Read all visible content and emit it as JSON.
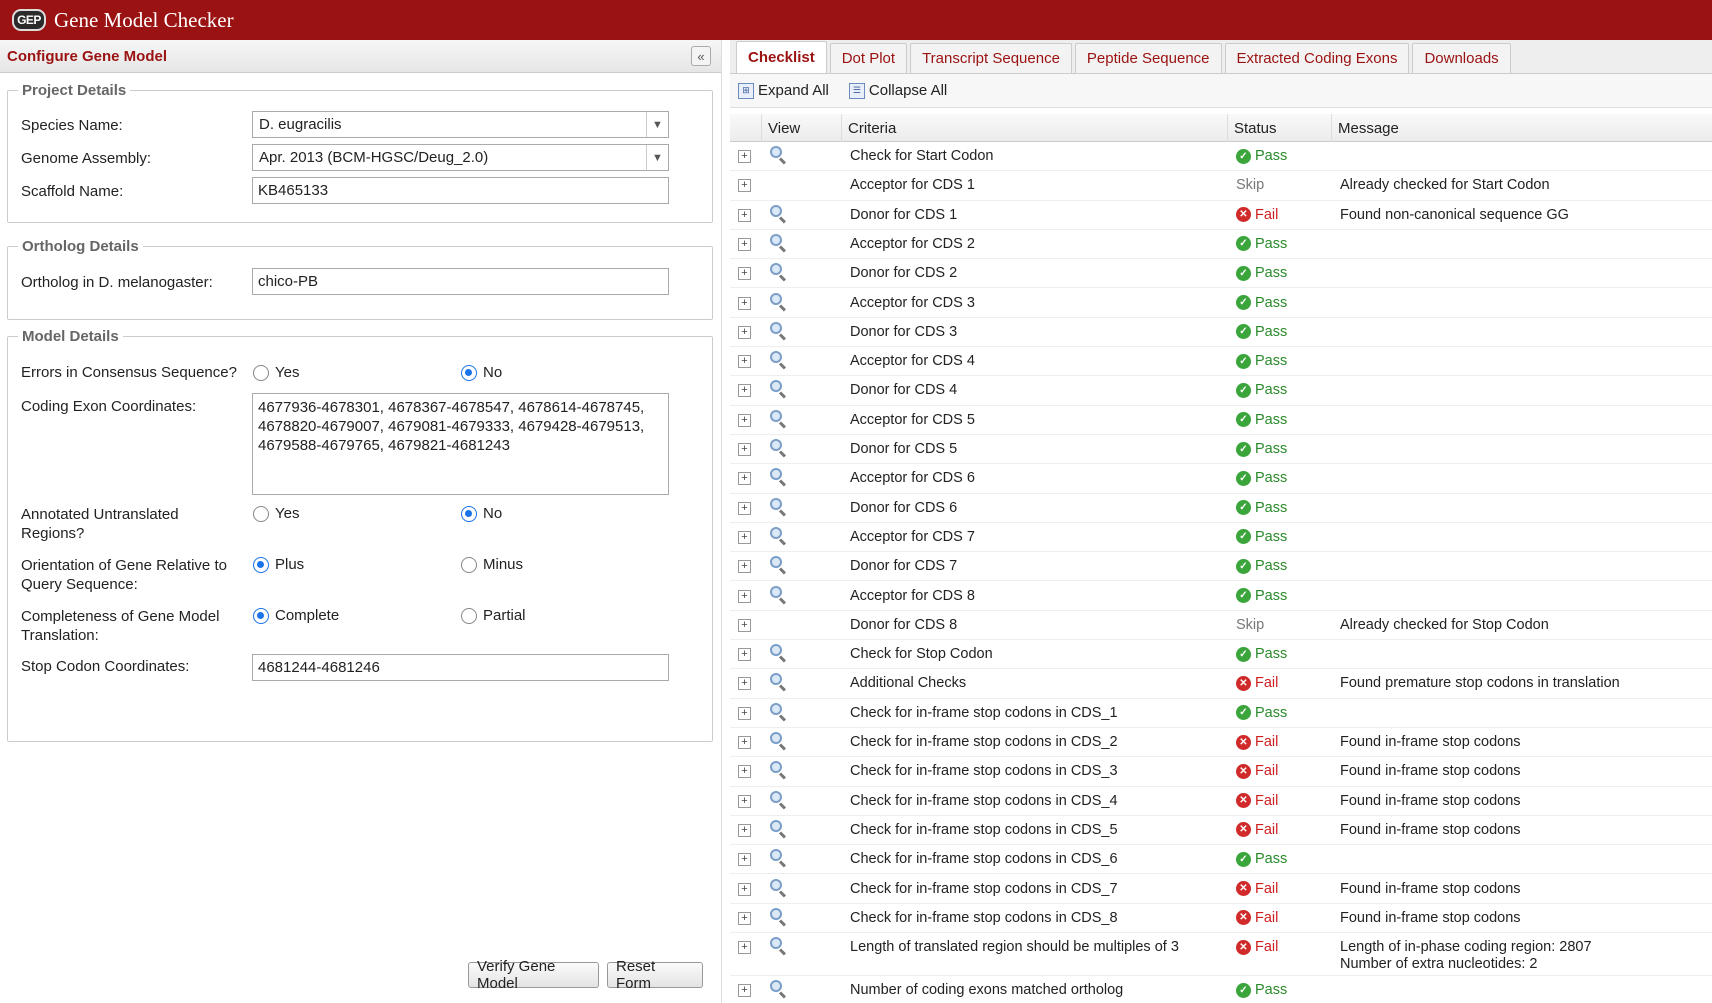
{
  "app": {
    "logo": "GEP",
    "title": "Gene Model Checker"
  },
  "left": {
    "title": "Configure Gene Model",
    "collapse_icon": "«",
    "project": {
      "legend": "Project Details",
      "species_label": "Species Name:",
      "species_value": "D. eugracilis",
      "assembly_label": "Genome Assembly:",
      "assembly_value": "Apr. 2013 (BCM-HGSC/Deug_2.0)",
      "scaffold_label": "Scaffold Name:",
      "scaffold_value": "KB465133"
    },
    "ortholog": {
      "legend": "Ortholog Details",
      "label": "Ortholog in D. melanogaster:",
      "value": "chico-PB"
    },
    "model": {
      "legend": "Model Details",
      "errors_label": "Errors in Consensus Sequence?",
      "exon_label": "Coding Exon Coordinates:",
      "exon_value": "4677936-4678301, 4678367-4678547, 4678614-4678745, 4678820-4679007, 4679081-4679333, 4679428-4679513, 4679588-4679765, 4679821-4681243",
      "utr_label_1": "Annotated Untranslated",
      "utr_label_2": "Regions?",
      "orient_label_1": "Orientation of Gene Relative to",
      "orient_label_2": "Query Sequence:",
      "complete_label_1": "Completeness of Gene Model",
      "complete_label_2": "Translation:",
      "stop_label": "Stop Codon Coordinates:",
      "stop_value": "4681244-4681246",
      "yes": "Yes",
      "no": "No",
      "plus": "Plus",
      "minus": "Minus",
      "complete": "Complete",
      "partial": "Partial"
    },
    "verify_button": "Verify Gene Model",
    "reset_button": "Reset Form"
  },
  "tabs": [
    "Checklist",
    "Dot Plot",
    "Transcript Sequence",
    "Peptide Sequence",
    "Extracted Coding Exons",
    "Downloads"
  ],
  "toolbar": {
    "expand": "Expand All",
    "collapse": "Collapse All"
  },
  "grid": {
    "headers": {
      "view": "View",
      "criteria": "Criteria",
      "status": "Status",
      "message": "Message"
    },
    "rows": [
      {
        "criteria": "Check for Start Codon",
        "status": "Pass",
        "message": "",
        "view": true
      },
      {
        "criteria": "Acceptor for CDS 1",
        "status": "Skip",
        "message": "Already checked for Start Codon",
        "view": false
      },
      {
        "criteria": "Donor for CDS 1",
        "status": "Fail",
        "message": "Found non-canonical sequence GG",
        "view": true
      },
      {
        "criteria": "Acceptor for CDS 2",
        "status": "Pass",
        "message": "",
        "view": true
      },
      {
        "criteria": "Donor for CDS 2",
        "status": "Pass",
        "message": "",
        "view": true
      },
      {
        "criteria": "Acceptor for CDS 3",
        "status": "Pass",
        "message": "",
        "view": true
      },
      {
        "criteria": "Donor for CDS 3",
        "status": "Pass",
        "message": "",
        "view": true
      },
      {
        "criteria": "Acceptor for CDS 4",
        "status": "Pass",
        "message": "",
        "view": true
      },
      {
        "criteria": "Donor for CDS 4",
        "status": "Pass",
        "message": "",
        "view": true
      },
      {
        "criteria": "Acceptor for CDS 5",
        "status": "Pass",
        "message": "",
        "view": true
      },
      {
        "criteria": "Donor for CDS 5",
        "status": "Pass",
        "message": "",
        "view": true
      },
      {
        "criteria": "Acceptor for CDS 6",
        "status": "Pass",
        "message": "",
        "view": true
      },
      {
        "criteria": "Donor for CDS 6",
        "status": "Pass",
        "message": "",
        "view": true
      },
      {
        "criteria": "Acceptor for CDS 7",
        "status": "Pass",
        "message": "",
        "view": true
      },
      {
        "criteria": "Donor for CDS 7",
        "status": "Pass",
        "message": "",
        "view": true
      },
      {
        "criteria": "Acceptor for CDS 8",
        "status": "Pass",
        "message": "",
        "view": true
      },
      {
        "criteria": "Donor for CDS 8",
        "status": "Skip",
        "message": "Already checked for Stop Codon",
        "view": false
      },
      {
        "criteria": "Check for Stop Codon",
        "status": "Pass",
        "message": "",
        "view": true
      },
      {
        "criteria": "Additional Checks",
        "status": "Fail",
        "message": "Found premature stop codons in translation",
        "view": true
      },
      {
        "criteria": "Check for in-frame stop codons in CDS_1",
        "status": "Pass",
        "message": "",
        "view": true
      },
      {
        "criteria": "Check for in-frame stop codons in CDS_2",
        "status": "Fail",
        "message": "Found in-frame stop codons",
        "view": true
      },
      {
        "criteria": "Check for in-frame stop codons in CDS_3",
        "status": "Fail",
        "message": "Found in-frame stop codons",
        "view": true
      },
      {
        "criteria": "Check for in-frame stop codons in CDS_4",
        "status": "Fail",
        "message": "Found in-frame stop codons",
        "view": true
      },
      {
        "criteria": "Check for in-frame stop codons in CDS_5",
        "status": "Fail",
        "message": "Found in-frame stop codons",
        "view": true
      },
      {
        "criteria": "Check for in-frame stop codons in CDS_6",
        "status": "Pass",
        "message": "",
        "view": true
      },
      {
        "criteria": "Check for in-frame stop codons in CDS_7",
        "status": "Fail",
        "message": "Found in-frame stop codons",
        "view": true
      },
      {
        "criteria": "Check for in-frame stop codons in CDS_8",
        "status": "Fail",
        "message": "Found in-frame stop codons",
        "view": true
      },
      {
        "criteria": "Length of translated region should be multiples of 3",
        "status": "Fail",
        "message": "Length of in-phase coding region: 2807",
        "message2": "Number of extra nucleotides: 2",
        "view": true
      },
      {
        "criteria": "Number of coding exons matched ortholog",
        "status": "Pass",
        "message": "",
        "view": true
      }
    ]
  },
  "colors": {
    "header": "#9b1212",
    "pass": "#2a8a2a",
    "fail": "#cc1f1f"
  }
}
